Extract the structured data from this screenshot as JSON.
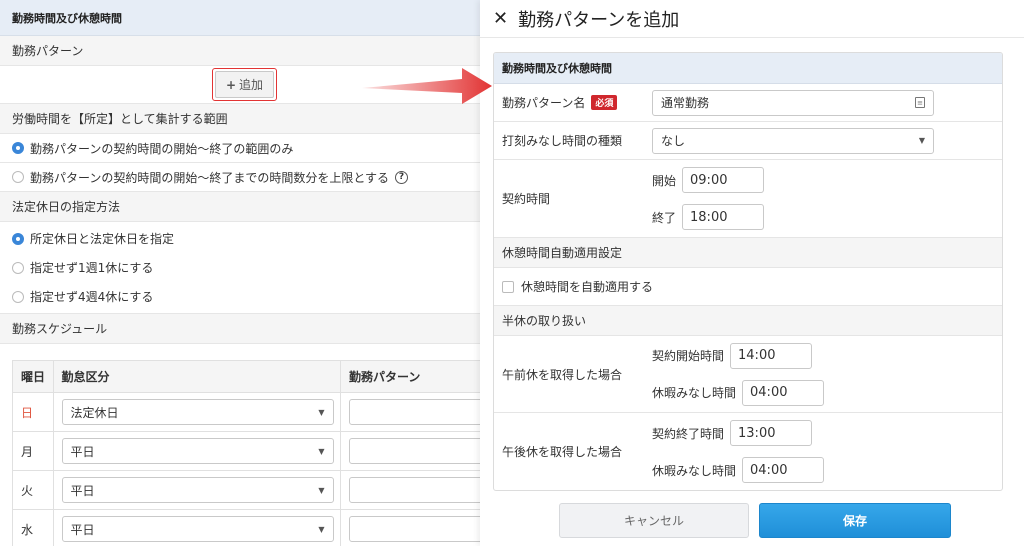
{
  "left": {
    "header": "勤務時間及び休憩時間",
    "pattern_label": "勤務パターン",
    "add_button": "追加",
    "aggregate_heading": "労働時間を【所定】として集計する範囲",
    "aggregate_options": [
      "勤務パターンの契約時間の開始〜終了の範囲のみ",
      "勤務パターンの契約時間の開始〜終了までの時間数分を上限とする"
    ],
    "holiday_heading": "法定休日の指定方法",
    "holiday_options": [
      "所定休日と法定休日を指定",
      "指定せず1週1休にする",
      "指定せず4週4休にする"
    ],
    "schedule_heading": "勤務スケジュール",
    "schedule": {
      "headers": [
        "曜日",
        "勤怠区分",
        "勤務パターン"
      ],
      "rows": [
        {
          "day": "日",
          "type": "法定休日"
        },
        {
          "day": "月",
          "type": "平日"
        },
        {
          "day": "火",
          "type": "平日"
        },
        {
          "day": "水",
          "type": "平日"
        }
      ]
    }
  },
  "panel": {
    "title": "勤務パターンを追加",
    "section_header": "勤務時間及び休憩時間",
    "pattern_name_label": "勤務パターン名",
    "required_badge": "必須",
    "pattern_name_value": "通常勤務",
    "stamp_type_label": "打刻みなし時間の種類",
    "stamp_type_value": "なし",
    "contract_label": "契約時間",
    "start_label": "開始",
    "start_value": "09:00",
    "end_label": "終了",
    "end_value": "18:00",
    "break_section": "休憩時間自動適用設定",
    "auto_break_label": "休憩時間を自動適用する",
    "half_section": "半休の取り扱い",
    "am_label": "午前休を取得した場合",
    "am_start_label": "契約開始時間",
    "am_start_value": "14:00",
    "am_rest_label": "休暇みなし時間",
    "am_rest_value": "04:00",
    "pm_label": "午後休を取得した場合",
    "pm_end_label": "契約終了時間",
    "pm_end_value": "13:00",
    "pm_rest_label": "休暇みなし時間",
    "pm_rest_value": "04:00",
    "cancel_button": "キャンセル",
    "save_button": "保存"
  },
  "colors": {
    "accent": "#1f8fd8",
    "required": "#d0272d",
    "highlight": "#e23434",
    "header_bg": "#e6edf6"
  }
}
